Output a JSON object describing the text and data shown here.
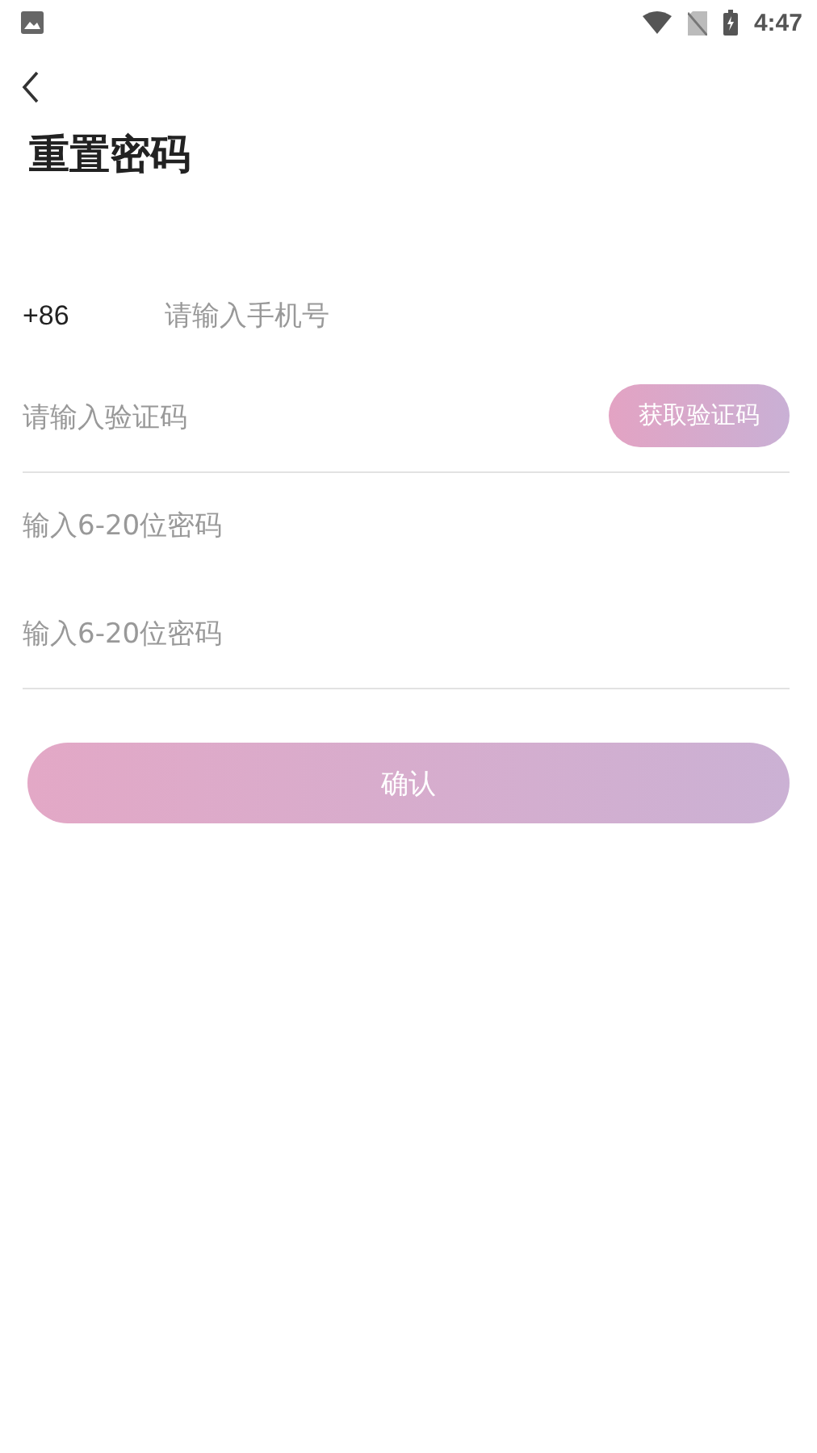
{
  "status_bar": {
    "time": "4:47"
  },
  "title": "重置密码",
  "fields": [
    {
      "kind": "phone",
      "prefix": "+86",
      "placeholder": "请输入手机号",
      "underline": false
    },
    {
      "kind": "code",
      "placeholder": "请输入验证码",
      "button": "获取验证码",
      "underline": true
    },
    {
      "kind": "password",
      "placeholder": "输入6-20位密码",
      "underline": false
    },
    {
      "kind": "password",
      "placeholder": "输入6-20位密码",
      "underline": true
    }
  ],
  "confirm_button": "确认"
}
